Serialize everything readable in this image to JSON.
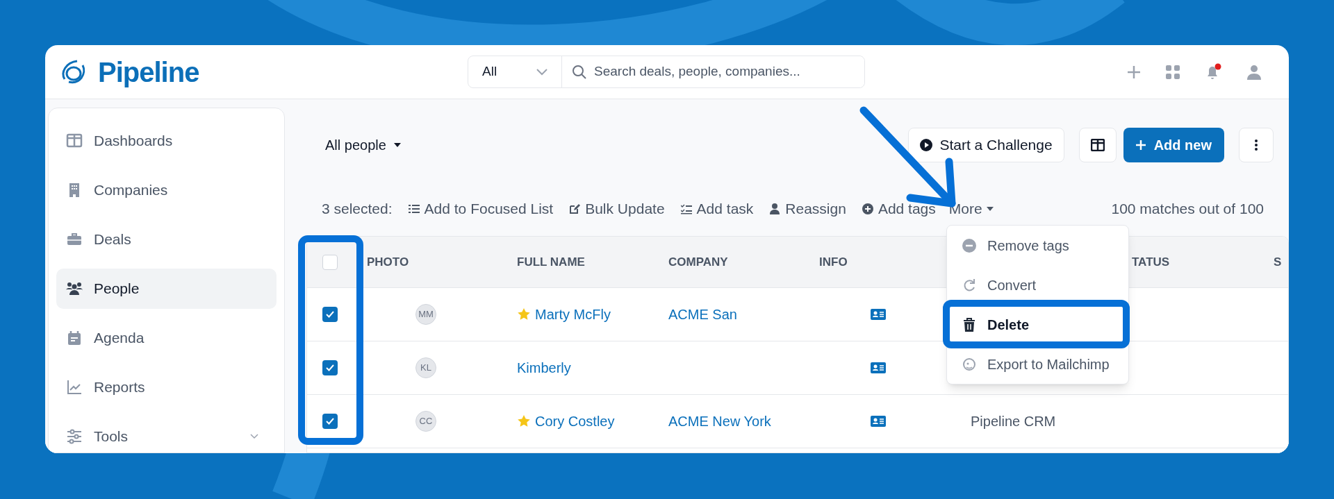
{
  "app": {
    "logo_text": "Pipeline"
  },
  "search": {
    "scope": "All",
    "placeholder": "Search deals, people, companies..."
  },
  "notifications": {
    "unread": true
  },
  "sidebar": {
    "items": [
      {
        "label": "Dashboards",
        "kind": "dashboard",
        "selected": false
      },
      {
        "label": "Companies",
        "kind": "building",
        "selected": false
      },
      {
        "label": "Deals",
        "kind": "briefcase",
        "selected": false
      },
      {
        "label": "People",
        "kind": "people",
        "selected": true
      },
      {
        "label": "Agenda",
        "kind": "calendar",
        "selected": false
      },
      {
        "label": "Reports",
        "kind": "chart",
        "selected": false
      },
      {
        "label": "Tools",
        "kind": "sliders",
        "selected": false,
        "expanded": false
      }
    ]
  },
  "view": {
    "title": "All people"
  },
  "header_buttons": [
    {
      "label": "Start a Challenge",
      "kind": "challenge"
    },
    {
      "kind": "layout"
    },
    {
      "label": "Add new",
      "kind": "primary"
    },
    {
      "kind": "more"
    }
  ],
  "bulk_bar": {
    "selection": "3 selected:",
    "actions": [
      {
        "label": "Add to Focused List",
        "kind": "list"
      },
      {
        "label": "Bulk Update",
        "kind": "edit"
      },
      {
        "label": "Add task",
        "kind": "task"
      },
      {
        "label": "Reassign",
        "kind": "person"
      },
      {
        "label": "Add tags",
        "kind": "tag"
      }
    ],
    "more": "More",
    "count": "100 matches out of 100"
  },
  "table": {
    "select_all_checked": false,
    "columns": [
      "PHOTO",
      "FULL NAME",
      "COMPANY",
      "INFO",
      "TATUS",
      "S"
    ],
    "rows": [
      {
        "checked": true,
        "initials": "MM",
        "starred": true,
        "name": "Marty McFly",
        "company": "ACME San"
      },
      {
        "checked": true,
        "initials": "KL",
        "starred": false,
        "name": "Kimberly"
      },
      {
        "checked": true,
        "initials": "CC",
        "starred": true,
        "name": "Cory Costley",
        "company": "ACME New York",
        "column_6": "Pipeline CRM"
      }
    ]
  },
  "more_menu": {
    "items": [
      {
        "label": "Remove tags",
        "kind": "remove",
        "selected": false
      },
      {
        "label": "Convert",
        "kind": "convert",
        "selected": false
      },
      {
        "label": "Delete",
        "kind": "delete",
        "selected": true
      },
      {
        "label": "Export to Mailchimp",
        "kind": "export",
        "selected": false
      }
    ]
  }
}
